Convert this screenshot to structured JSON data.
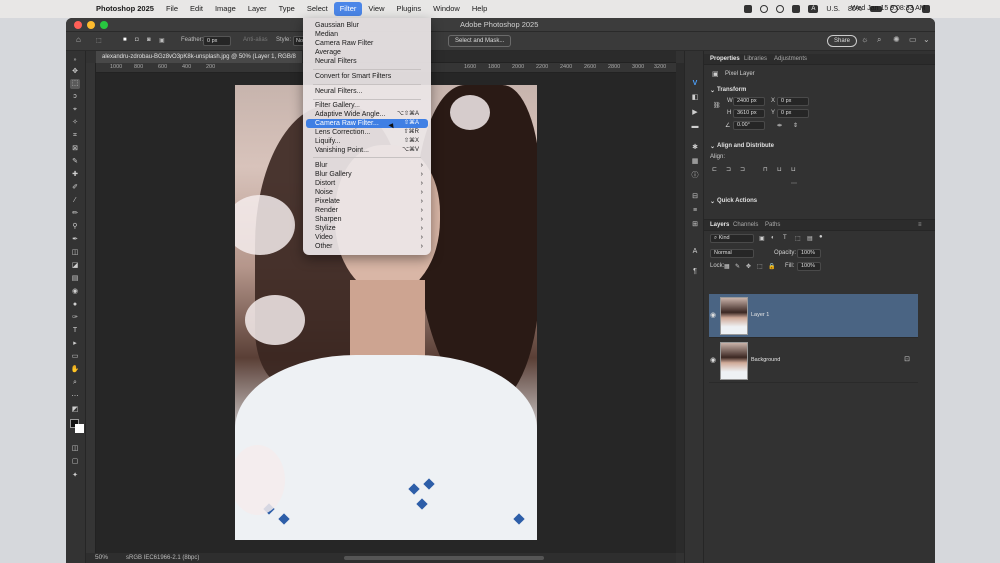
{
  "menubar": {
    "app_name": "Photoshop 2025",
    "items": [
      "File",
      "Edit",
      "Image",
      "Layer",
      "Type",
      "Select",
      "Filter",
      "View",
      "Plugins",
      "Window",
      "Help"
    ],
    "active_item": "Filter",
    "input_source": "U.S.",
    "input_badge": "A",
    "battery": "80%",
    "clock": "Wed Jan 15  9:08:33 AM"
  },
  "window": {
    "title": "Adobe Photoshop 2025",
    "doc_tab": "alexandru-zdrobau-BGz8vO3pK8k-unsplash.jpg @ 50% (Layer 1, RGB/8",
    "zoom": "50%",
    "color_profile": "sRGB IEC61966-2.1 (8bpc)"
  },
  "options_bar": {
    "feather_label": "Feather:",
    "feather_value": "0 px",
    "antialias_label": "Anti-alias",
    "style_label": "Style:",
    "style_value": "No",
    "select_mask_button": "Select and Mask...",
    "share_button": "Share"
  },
  "ruler_ticks": [
    "1000",
    "800",
    "600",
    "400",
    "200",
    "1600",
    "1800",
    "2000",
    "2200",
    "2400",
    "2600",
    "2800",
    "3000",
    "3200",
    "3400"
  ],
  "filter_menu": {
    "top_items": [
      "Gaussian Blur",
      "Median",
      "Camera Raw Filter",
      "Average",
      "Neural Filters"
    ],
    "convert_item": "Convert for Smart Filters",
    "neural_item": "Neural Filters...",
    "mid_items": [
      {
        "label": "Filter Gallery...",
        "shortcut": ""
      },
      {
        "label": "Adaptive Wide Angle...",
        "shortcut": "⌥⇧⌘A"
      },
      {
        "label": "Camera Raw Filter...",
        "shortcut": "⇧⌘A"
      },
      {
        "label": "Lens Correction...",
        "shortcut": "⇧⌘R"
      },
      {
        "label": "Liquify...",
        "shortcut": "⇧⌘X"
      },
      {
        "label": "Vanishing Point...",
        "shortcut": "⌥⌘V"
      }
    ],
    "highlighted": "Camera Raw Filter...",
    "submenus": [
      "Blur",
      "Blur Gallery",
      "Distort",
      "Noise",
      "Pixelate",
      "Render",
      "Sharpen",
      "Stylize",
      "Video",
      "Other"
    ]
  },
  "properties_panel": {
    "tabs": [
      "Properties",
      "Libraries",
      "Adjustments"
    ],
    "layer_type": "Pixel Layer",
    "transform_title": "Transform",
    "w_label": "W",
    "w_value": "2400 px",
    "h_label": "H",
    "h_value": "3610 px",
    "x_label": "X",
    "x_value": "0 px",
    "y_label": "Y",
    "y_value": "0 px",
    "angle_value": "0.00°",
    "align_title": "Align and Distribute",
    "align_label": "Align:",
    "quick_actions_title": "Quick Actions"
  },
  "layers_panel": {
    "tabs": [
      "Layers",
      "Channels",
      "Paths"
    ],
    "filter_kind": "Kind",
    "blend_mode": "Normal",
    "opacity_label": "Opacity:",
    "opacity_value": "100%",
    "lock_label": "Lock:",
    "fill_label": "Fill:",
    "fill_value": "100%",
    "layers": [
      {
        "name": "Layer 1",
        "selected": true
      },
      {
        "name": "Background",
        "selected": false,
        "locked": true
      }
    ]
  },
  "colors": {
    "menu_highlight": "#3f7fe4",
    "layer_selected": "#4a6483",
    "panel_bg": "#323232"
  }
}
